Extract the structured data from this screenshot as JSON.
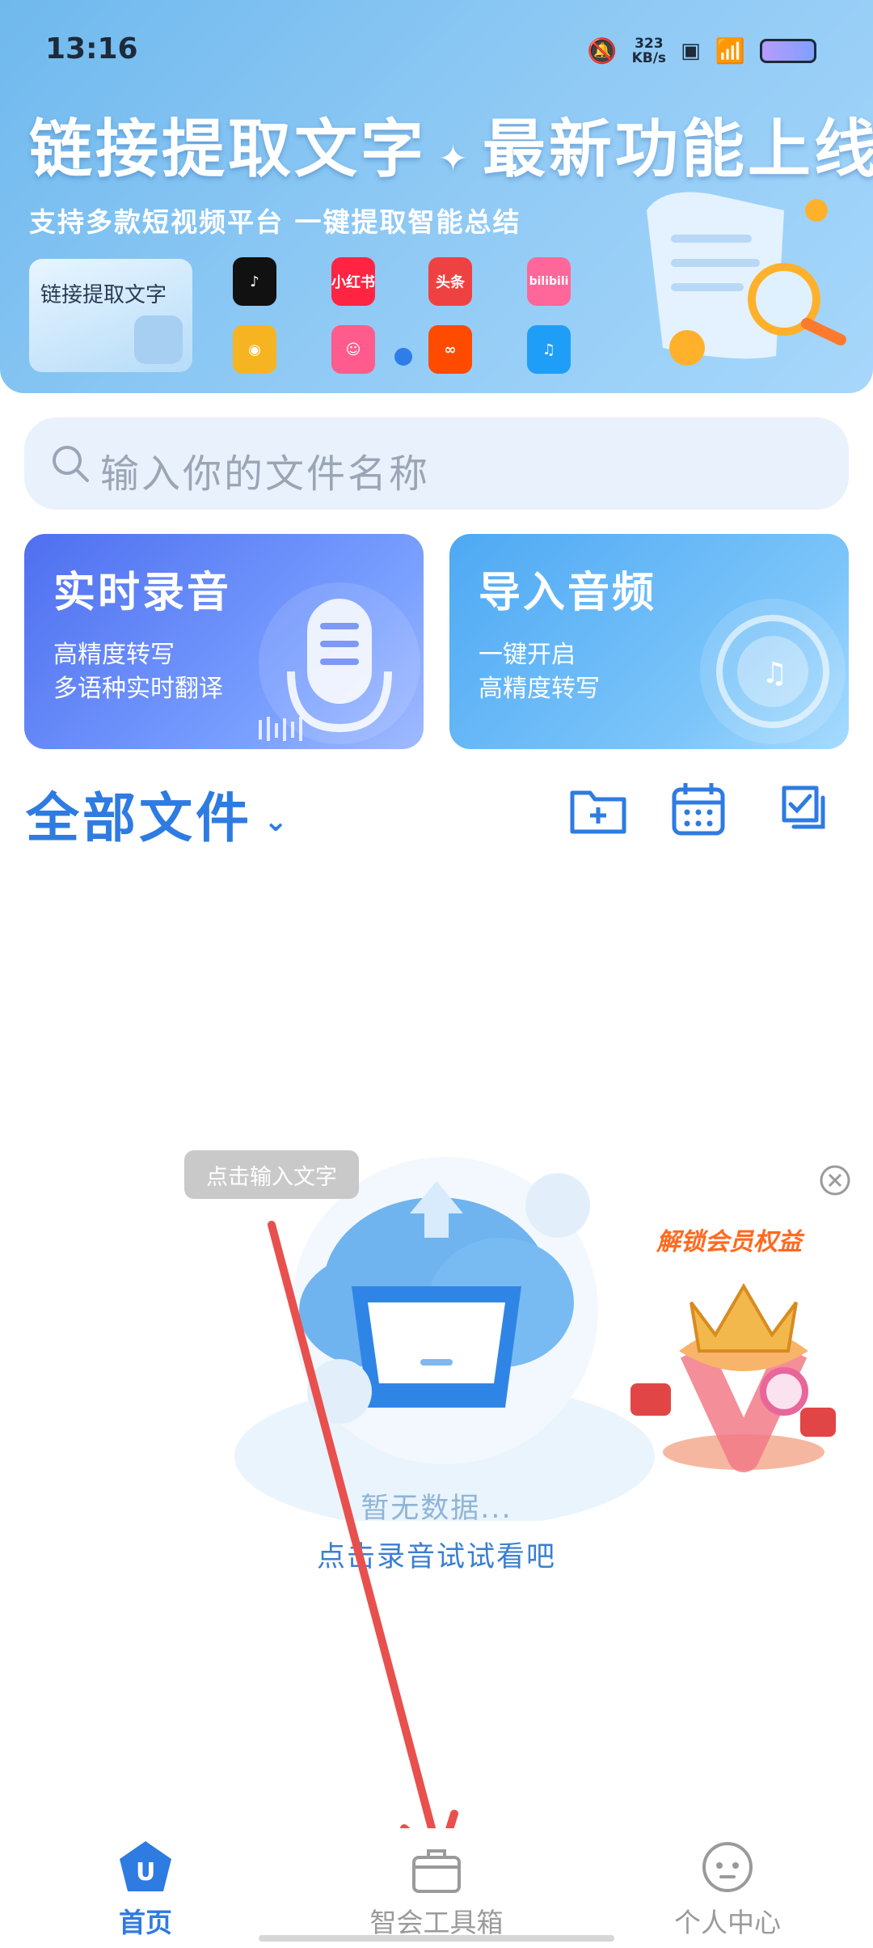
{
  "status": {
    "time": "13:16",
    "speed_value": "323",
    "speed_unit": "KB/s"
  },
  "banner": {
    "title_left": "链接提取文字",
    "title_right": "最新功能上线",
    "subtitle": "支持多款短视频平台  一键提取智能总结",
    "link_card_label": "链接提取文字",
    "apps": [
      {
        "name": "douyin-icon",
        "label": "",
        "color": "#111111"
      },
      {
        "name": "xiaohongshu-icon",
        "label": "小红书",
        "color": "#ff2442"
      },
      {
        "name": "toutiao-icon",
        "label": "头条",
        "color": "#f04142"
      },
      {
        "name": "bilibili-icon",
        "label": "bilibili",
        "color": "#ff6699"
      },
      {
        "name": "weibo-icon",
        "label": "",
        "color": "#f7b422"
      },
      {
        "name": "pipixia-icon",
        "label": "",
        "color": "#ff5b8c"
      },
      {
        "name": "kuaishou-icon",
        "label": "",
        "color": "#ff4b00"
      },
      {
        "name": "qq-music-icon",
        "label": "",
        "color": "#1f9ef7"
      }
    ]
  },
  "search": {
    "placeholder": "输入你的文件名称"
  },
  "cards": {
    "record": {
      "title": "实时录音",
      "line1": "高精度转写",
      "line2": "多语种实时翻译"
    },
    "import": {
      "title": "导入音频",
      "line1": "一键开启",
      "line2": "高精度转写"
    }
  },
  "files": {
    "title": "全部文件"
  },
  "empty": {
    "hint": "点击输入文字",
    "title": "暂无数据...",
    "subtitle": "点击录音试试看吧"
  },
  "promo": {
    "label": "解锁会员权益"
  },
  "nav": {
    "home": "首页",
    "toolbox": "智会工具箱",
    "profile": "个人中心"
  },
  "colors": {
    "accent": "#2e7be2",
    "arrow": "#e8504e",
    "record_card": "#4f6ff0",
    "import_card": "#5fb6f6"
  }
}
